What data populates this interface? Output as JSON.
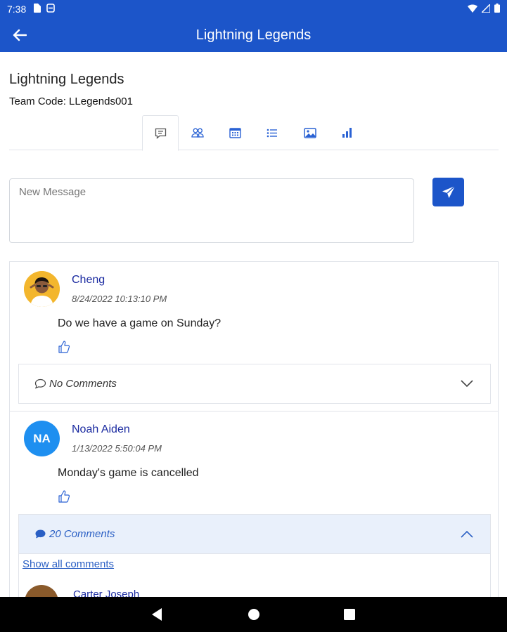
{
  "status_bar": {
    "time": "7:38"
  },
  "app_bar": {
    "title": "Lightning Legends"
  },
  "team": {
    "name": "Lightning Legends",
    "code_text": "Team Code: LLegends001"
  },
  "tabs": [
    {
      "icon": "chat-icon",
      "active": true
    },
    {
      "icon": "people-icon",
      "active": false
    },
    {
      "icon": "calendar-icon",
      "active": false
    },
    {
      "icon": "list-icon",
      "active": false
    },
    {
      "icon": "image-icon",
      "active": false
    },
    {
      "icon": "bar-chart-icon",
      "active": false
    }
  ],
  "composer": {
    "placeholder": "New Message"
  },
  "posts": [
    {
      "author": "Cheng",
      "date": "8/24/2022 10:13:10 PM",
      "body": "Do we have a game on Sunday?",
      "comments_label": "No Comments"
    },
    {
      "author": "Noah Aiden",
      "initials": "NA",
      "date": "1/13/2022 5:50:04 PM",
      "body": "Monday's game is cancelled",
      "comments_label": "20 Comments",
      "show_all": "Show all comments",
      "first_comment_author": "Carter Joseph"
    }
  ],
  "colors": {
    "primary": "#1c55c9",
    "author": "#1a2aa0",
    "avatar_blue": "#1e8ff0",
    "comments_open_bg": "#e9f0fb"
  }
}
